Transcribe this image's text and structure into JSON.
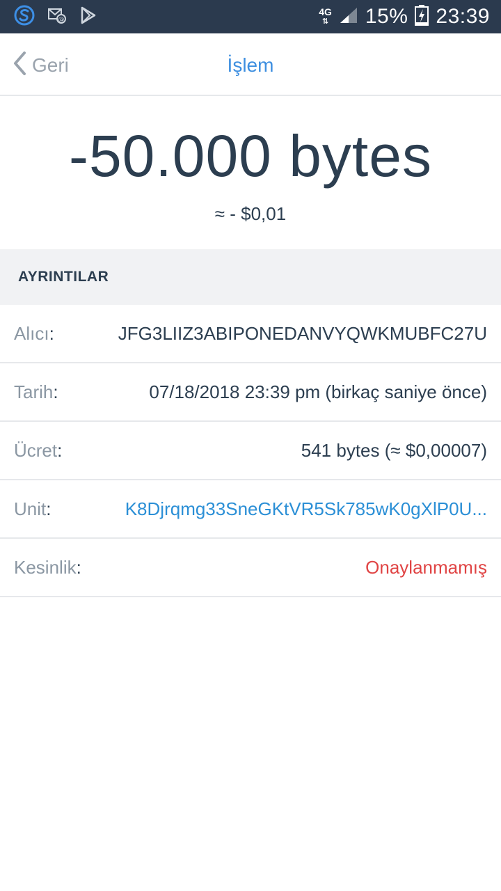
{
  "status_bar": {
    "network": "4G",
    "battery": "15%",
    "time": "23:39"
  },
  "header": {
    "back_label": "Geri",
    "title": "İşlem"
  },
  "amount": {
    "value": "-50.000 bytes",
    "fiat": "≈ - $0,01"
  },
  "details": {
    "section_title": "AYRINTILAR",
    "rows": [
      {
        "label": "Alıcı",
        "value": "JFG3LIIZ3ABIPONEDANVYQWKMUBFC27U"
      },
      {
        "label": "Tarih",
        "value": "07/18/2018 23:39 pm (birkaç saniye önce)"
      },
      {
        "label": "Ücret",
        "value": "541 bytes (≈ $0,00007)"
      },
      {
        "label": "Unit",
        "value": "K8Djrqmg33SneGKtVR5Sk785wK0gXlP0U..."
      },
      {
        "label": "Kesinlik",
        "value": "Onaylanmamış"
      }
    ]
  },
  "colors": {
    "status_bar_bg": "#2b3a4e",
    "accent": "#3e8fe0",
    "link": "#2b8fd6",
    "warning": "#e04444",
    "text": "#2c3e50",
    "label": "#8b97a3"
  }
}
